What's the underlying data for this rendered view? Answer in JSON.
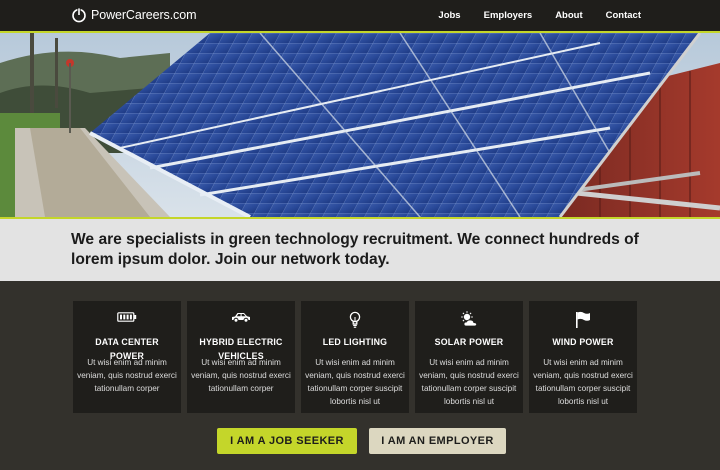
{
  "header": {
    "brand": "PowerCareers.com",
    "nav": [
      "Jobs",
      "Employers",
      "About",
      "Contact"
    ]
  },
  "tagline": "We are specialists in green technology recruitment. We connect hundreds of lorem ipsum dolor. Join our network today.",
  "cards": [
    {
      "icon": "battery-icon",
      "title_lines": [
        "DATA CENTER",
        "POWER"
      ],
      "body": "Ut wisi enim ad minim veniam, quis nostrud exerci tationullam corper"
    },
    {
      "icon": "car-icon",
      "title_lines": [
        "HYBRID ELECTRIC",
        "VEHICLES"
      ],
      "body": "Ut wisi enim ad minim veniam, quis nostrud exerci tationullam corper"
    },
    {
      "icon": "lightbulb-icon",
      "title_lines": [
        "LED LIGHTING"
      ],
      "body": "Ut wisi enim ad minim veniam, quis nostrud exerci tationullam corper suscipit lobortis nisl ut"
    },
    {
      "icon": "sun-cloud-icon",
      "title_lines": [
        "SOLAR POWER"
      ],
      "body": "Ut wisi enim ad minim veniam, quis nostrud exerci tationullam corper suscipit lobortis nisl ut"
    },
    {
      "icon": "flag-icon",
      "title_lines": [
        "WIND POWER"
      ],
      "body": "Ut wisi enim ad minim veniam, quis nostrud exerci tationullam corper suscipit lobortis nisl ut"
    }
  ],
  "buttons": {
    "job_seeker": "I AM A JOB SEEKER",
    "employer": "I AM AN EMPLOYER"
  },
  "colors": {
    "accent": "#c4d62a",
    "header_bg": "#1f1e1b",
    "page_bg": "#33312c",
    "card_bg": "#1f1e1b",
    "tagline_bg": "#e3e3e3",
    "employer_button": "#dcd7c0"
  }
}
